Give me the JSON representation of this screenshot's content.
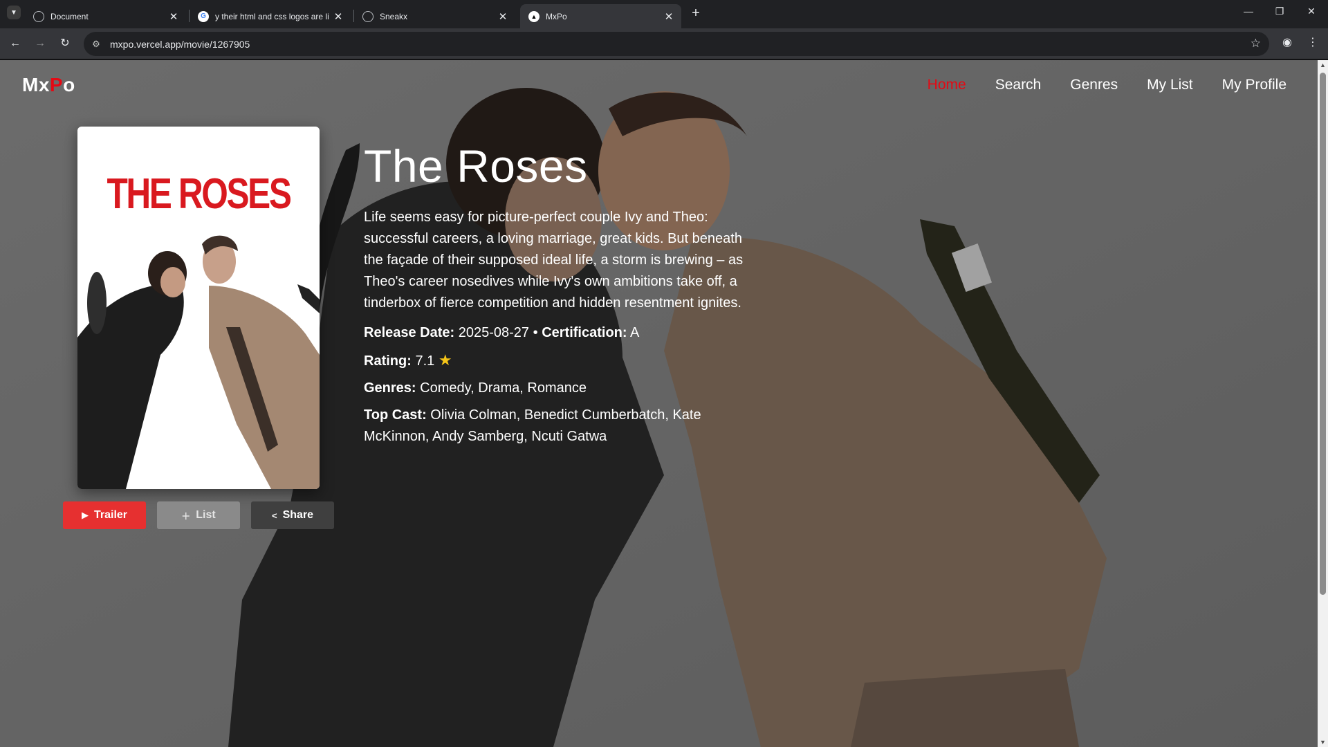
{
  "browser": {
    "tabs": [
      {
        "title": "Document",
        "active": false
      },
      {
        "title": "y their html and css logos are li",
        "active": false
      },
      {
        "title": "Sneakx",
        "active": false
      },
      {
        "title": "MxPo",
        "active": true
      }
    ],
    "url": "mxpo.vercel.app/movie/1267905"
  },
  "site": {
    "logo_main": "Mx",
    "logo_accent": "P",
    "logo_tail": "o",
    "nav": [
      "Home",
      "Search",
      "Genres",
      "My List",
      "My Profile"
    ],
    "active_nav": "Home",
    "accent_color": "#e50914"
  },
  "movie": {
    "poster_title": "THE ROSES",
    "title": "The Roses",
    "overview": "Life seems easy for picture-perfect couple Ivy and Theo: successful careers, a loving marriage, great kids. But beneath the façade of their supposed ideal life, a storm is brewing – as Theo's career nosedives while Ivy's own ambitions take off, a tinderbox of fierce competition and hidden resentment ignites.",
    "release_label": "Release Date:",
    "release_date": "2025-08-27",
    "separator": "•",
    "certification_label": "Certification:",
    "certification": "A",
    "rating_label": "Rating:",
    "rating": "7.1",
    "genres_label": "Genres:",
    "genres": "Comedy, Drama, Romance",
    "cast_label": "Top Cast:",
    "cast": "Olivia Colman, Benedict Cumberbatch, Kate McKinnon, Andy Samberg, Ncuti Gatwa"
  },
  "actions": {
    "trailer": "Trailer",
    "list": "List",
    "share": "Share"
  },
  "icons": {
    "trailer": "play-icon",
    "list": "plus-icon",
    "share": "share-icon",
    "rating": "star-icon"
  }
}
